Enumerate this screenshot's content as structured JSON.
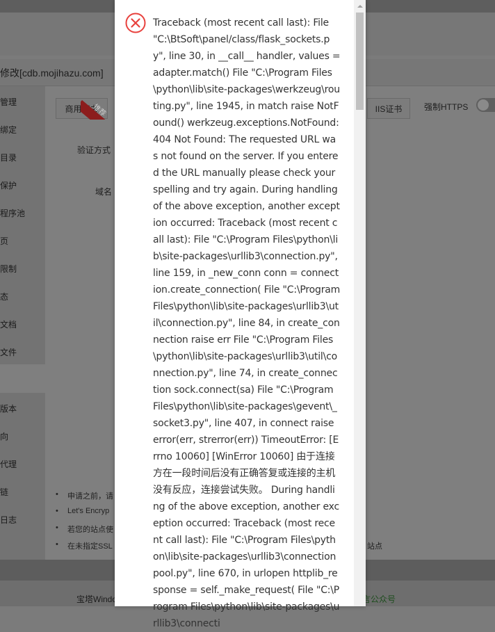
{
  "window": {
    "title": "修改[cdb.mojihazu.com]"
  },
  "sidebar": {
    "items": [
      {
        "label": "管理"
      },
      {
        "label": "绑定"
      },
      {
        "label": "目录"
      },
      {
        "label": "保护"
      },
      {
        "label": "程序池"
      },
      {
        "label": "页"
      },
      {
        "label": "限制"
      },
      {
        "label": "态"
      },
      {
        "label": "文档"
      },
      {
        "label": "文件"
      }
    ],
    "items2": [
      {
        "label": "版本"
      },
      {
        "label": "向"
      },
      {
        "label": "代理"
      },
      {
        "label": "链"
      },
      {
        "label": "日志"
      }
    ]
  },
  "tabs": {
    "commercial": "商用证书",
    "badge": "推荐",
    "iis": "IIS证书"
  },
  "force_https_label": "强制HTTPS",
  "form": {
    "verify_label": "验证方式",
    "domain_label": "域名"
  },
  "tips": [
    {
      "text": "申请之前，请"
    },
    {
      "text": "Let's Encryp"
    },
    {
      "text": "若您的站点使"
    },
    {
      "text": "在未指定SSL"
    }
  ],
  "tip_tail": "站点",
  "footer": {
    "left": "宝塔Windo",
    "right": "言公众号"
  },
  "error": {
    "message": "Traceback (most recent call last): File \"C:\\BtSoft\\panel/class/flask_sockets.py\", line 30, in __call__ handler, values = adapter.match() File \"C:\\Program Files\\python\\lib\\site-packages\\werkzeug\\routing.py\", line 1945, in match raise NotFound() werkzeug.exceptions.NotFound: 404 Not Found: The requested URL was not found on the server. If you entered the URL manually please check your spelling and try again. During handling of the above exception, another exception occurred: Traceback (most recent call last): File \"C:\\Program Files\\python\\lib\\site-packages\\urllib3\\connection.py\", line 159, in _new_conn conn = connection.create_connection( File \"C:\\Program Files\\python\\lib\\site-packages\\urllib3\\util\\connection.py\", line 84, in create_connection raise err File \"C:\\Program Files\\python\\lib\\site-packages\\urllib3\\util\\connection.py\", line 74, in create_connection sock.connect(sa) File \"C:\\Program Files\\python\\lib\\site-packages\\gevent\\_socket3.py\", line 407, in connect raise error(err, strerror(err)) TimeoutError: [Errno 10060] [WinError 10060] 由于连接方在一段时间后没有正确答复或连接的主机没有反应，连接尝试失败。 During handling of the above exception, another exception occurred: Traceback (most recent call last): File \"C:\\Program Files\\python\\lib\\site-packages\\urllib3\\connectionpool.py\", line 670, in urlopen httplib_response = self._make_request( File \"C:\\Program Files\\python\\lib\\site-packages\\urllib3\\connecti",
    "icon": "close-circle-icon",
    "color": "#e8413d"
  }
}
